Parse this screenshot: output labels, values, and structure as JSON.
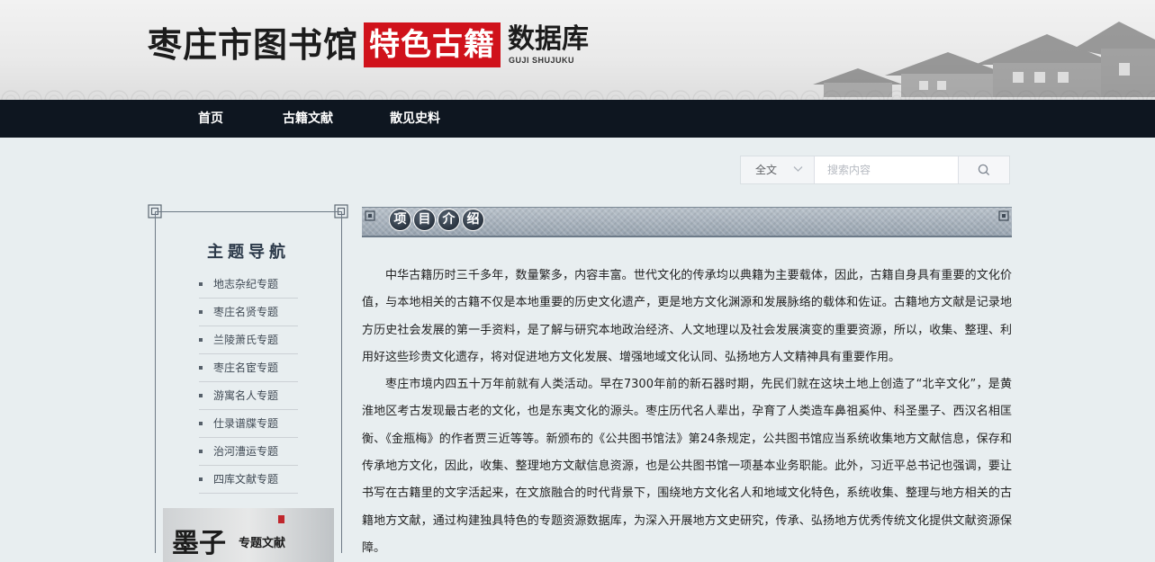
{
  "header": {
    "title_main": "枣庄市图书馆",
    "title_highlight": "特色古籍",
    "title_db": "数据库",
    "title_pinyin": "GUJI SHUJUKU"
  },
  "nav": {
    "items": [
      {
        "label": "首页"
      },
      {
        "label": "古籍文献"
      },
      {
        "label": "散见史料"
      }
    ]
  },
  "search": {
    "scope_value": "全文",
    "placeholder": "搜索内容"
  },
  "sidebar": {
    "title": "主题导航",
    "items": [
      {
        "label": "地志杂纪专题"
      },
      {
        "label": "枣庄名贤专题"
      },
      {
        "label": "兰陵萧氏专题"
      },
      {
        "label": "枣庄名宦专题"
      },
      {
        "label": "游寓名人专题"
      },
      {
        "label": "仕录谱牒专题"
      },
      {
        "label": "治河漕运专题"
      },
      {
        "label": "四库文献专题"
      }
    ],
    "banner": {
      "big": "墨子",
      "small": "专题文献"
    }
  },
  "section": {
    "title_chars": [
      "项",
      "目",
      "介",
      "绍"
    ]
  },
  "article": {
    "paragraphs": [
      "中华古籍历时三千多年，数量繁多，内容丰富。世代文化的传承均以典籍为主要载体，因此，古籍自身具有重要的文化价值，与本地相关的古籍不仅是本地重要的历史文化遗产，更是地方文化渊源和发展脉络的载体和佐证。古籍地方文献是记录地方历史社会发展的第一手资料，是了解与研究本地政治经济、人文地理以及社会发展演变的重要资源，所以，收集、整理、利用好这些珍贵文化遗存，将对促进地方文化发展、增强地域文化认同、弘扬地方人文精神具有重要作用。",
      "枣庄市境内四五十万年前就有人类活动。早在7300年前的新石器时期，先民们就在这块土地上创造了“北辛文化”，是黄淮地区考古发现最古老的文化，也是东夷文化的源头。枣庄历代名人辈出，孕育了人类造车鼻祖奚仲、科圣墨子、西汉名相匡衡、《金瓶梅》的作者贾三近等等。新颁布的《公共图书馆法》第24条规定，公共图书馆应当系统收集地方文献信息，保存和传承地方文化，因此，收集、整理地方文献信息资源，也是公共图书馆一项基本业务职能。此外，习近平总书记也强调，要让书写在古籍里的文字活起来，在文旅融合的时代背景下，围绕地方文化名人和地域文化特色，系统收集、整理与地方相关的古籍地方文献，通过构建独具特色的专题资源数据库，为深入开展地方文史研究，传承、弘扬地方优秀传统文化提供文献资源保障。"
    ]
  }
}
